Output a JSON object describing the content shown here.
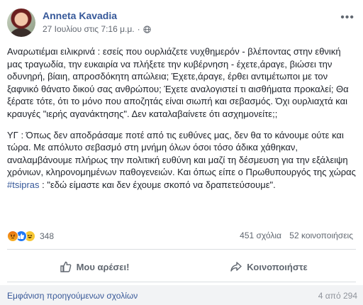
{
  "post": {
    "author": "Anneta Kavadia",
    "timestamp": "27 Ιουλίου στις 7:16 μ.μ.",
    "separator": "·",
    "privacy_icon": "globe-icon",
    "more_label": "•••",
    "paragraphs": [
      "Αναρωτιέμαι ειλικρινά : εσείς που ουρλιάζετε νυχθημερόν - βλέποντας στην εθνική μας τραγωδία, την ευκαιρία να πλήξετε την κυβέρνηση - έχετε,άραγε, βιώσει την οδυνηρή, βίαιη, απροσδόκητη απώλεια; Έχετε,άραγε, έρθει αντιμέτωποι με τον ξαφνικό θάνατο δικού σας ανθρώπου; Έχετε αναλογιστεί τι αισθήματα προκαλεί; Θα ξέρατε τότε, ότι το μόνο που αποζητάς είναι σιωπή και σεβασμός. Όχι ουρλιαχτά και κραυγές \"ιερής αγανάκτησης\". Δεν καταλαβαίνετε ότι ασχημονείτε;;"
    ],
    "ps_before_tag": "ΥΓ : Όπως δεν αποδράσαμε ποτέ από τις ευθύνες μας, δεν θα το κάνουμε ούτε και τώρα. Με απόλυτο σεβασμό στη μνήμη όλων όσοι τόσο άδικα χάθηκαν, αναλαμβάνουμε πλήρως την πολιτική ευθύνη και μαζί τη δέσμευση για την εξάλειψη χρόνιων, κληρονομημένων παθογενειών. Και όπως είπε ο Πρωθυπουργός της χώρας ",
    "hashtag": "#tsipras",
    "ps_after_tag": " : \"εδώ είμαστε και δεν έχουμε σκοπό να δραπετεύσουμε\"."
  },
  "stats": {
    "reactions": [
      "angry",
      "like",
      "haha"
    ],
    "reaction_count": "348",
    "comments": "451 σχόλια",
    "shares": "52 κοινοποιήσεις"
  },
  "actions": {
    "like": "Μου αρέσει!",
    "share": "Κοινοποιήστε"
  },
  "comments_bar": {
    "view_previous": "Εμφάνιση προηγούμενων σχολίων",
    "page_count": "4 από 294"
  },
  "colors": {
    "link": "#365899",
    "muted": "#606770",
    "like_blue": "#2078f4"
  }
}
